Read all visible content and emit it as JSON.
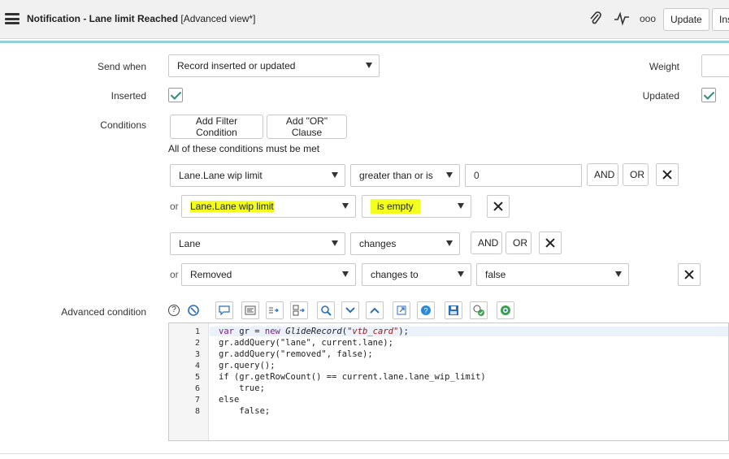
{
  "header": {
    "title_bold": "Notification - Lane limit Reached",
    "title_suffix": " [Advanced view*]",
    "icons": [
      "menu-icon",
      "paperclip-icon",
      "activity-icon",
      "more-icon"
    ],
    "more_label": "ooo",
    "update_label": "Update",
    "insert_label": "Ins"
  },
  "form": {
    "send_when": {
      "label": "Send when",
      "value": "Record inserted or updated"
    },
    "weight": {
      "label": "Weight",
      "value": ""
    },
    "inserted": {
      "label": "Inserted",
      "checked": true
    },
    "updated": {
      "label": "Updated",
      "checked": true
    },
    "conditions": {
      "label": "Conditions",
      "add_filter_label": "Add Filter Condition",
      "add_or_label": "Add \"OR\" Clause",
      "all_met_text": "All of these conditions must be met",
      "or_word": "or",
      "and_label": "AND",
      "or_label": "OR",
      "groups": [
        {
          "row1": {
            "field": "Lane.Lane wip limit",
            "operator": "greater than or is",
            "value": "0"
          },
          "row2": {
            "field": "Lane.Lane wip limit",
            "operator": "is empty"
          }
        },
        {
          "row1": {
            "field": "Lane",
            "operator": "changes"
          },
          "row2": {
            "field": "Removed",
            "operator": "changes to",
            "value": "false"
          }
        }
      ]
    },
    "advanced": {
      "label": "Advanced condition"
    }
  },
  "editor": {
    "line_numbers": [
      "1",
      "2",
      "3",
      "4",
      "5",
      "6",
      "7",
      "8"
    ],
    "lines": [
      "gr.addQuery(\"lane\", current.lane);",
      "gr.addQuery(\"removed\", false);",
      "gr.query();",
      "if (gr.getRowCount() == current.lane.lane_wip_limit)",
      "    true;",
      "else",
      "    false;"
    ],
    "line1": {
      "kw": "var",
      "mid": " gr = ",
      "kw2": "new",
      "fn": "GlideRecord",
      "open": "(",
      "str": "\"vtb_card\"",
      "close": ");"
    }
  },
  "colors": {
    "accent": "#92d0d8",
    "highlight": "#f3ff1e",
    "check": "#2e8b7a"
  }
}
